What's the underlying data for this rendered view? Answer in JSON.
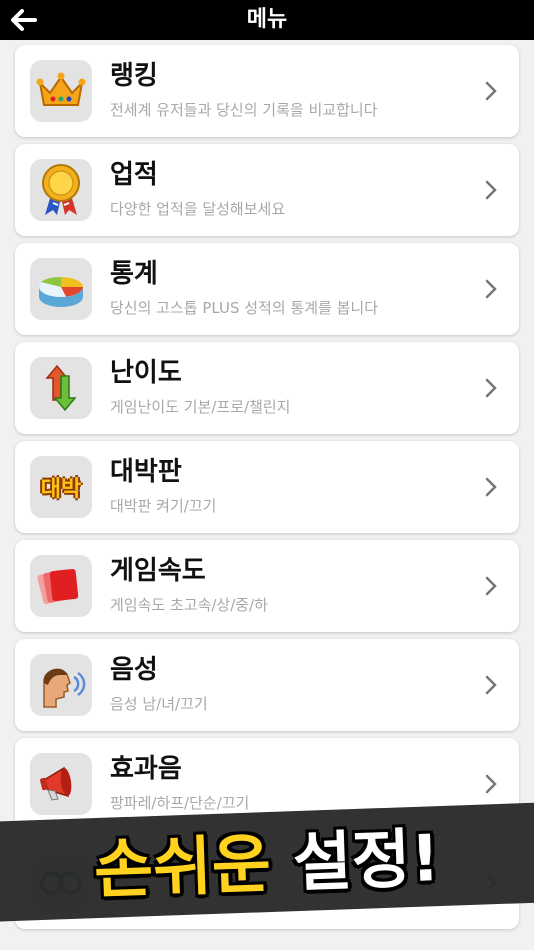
{
  "header": {
    "title": "메뉴",
    "back_icon": "arrow-left-icon"
  },
  "menu": [
    {
      "id": "ranking",
      "title": "랭킹",
      "subtitle": "전세계 유저들과 당신의 기록을 비교합니다",
      "icon": "crown-icon"
    },
    {
      "id": "achievement",
      "title": "업적",
      "subtitle": "다양한 업적을 달성해보세요",
      "icon": "medal-icon"
    },
    {
      "id": "statistics",
      "title": "통계",
      "subtitle": "당신의 고스톱 PLUS 성적의 통계를 봅니다",
      "icon": "pie-chart-icon"
    },
    {
      "id": "difficulty",
      "title": "난이도",
      "subtitle": "게임난이도 기본/프로/챌린지",
      "icon": "up-down-arrows-icon"
    },
    {
      "id": "jackpot",
      "title": "대박판",
      "subtitle": "대박판 켜기/끄기",
      "icon": "jackpot-icon",
      "icon_text": "대박"
    },
    {
      "id": "game-speed",
      "title": "게임속도",
      "subtitle": "게임속도 초고속/상/중/하",
      "icon": "cards-speed-icon"
    },
    {
      "id": "voice",
      "title": "음성",
      "subtitle": "음성 남/녀/끄기",
      "icon": "speaking-head-icon"
    },
    {
      "id": "sound-effect",
      "title": "효과음",
      "subtitle": "팡파레/하프/단순/끄기",
      "icon": "megaphone-icon"
    },
    {
      "id": "hidden-item",
      "title": "",
      "subtitle": "",
      "icon": "partially-hidden-icon"
    }
  ],
  "promo": {
    "part1": "손쉬운",
    "part2": "설정!"
  },
  "colors": {
    "topbar": "#000000",
    "background": "#f1f1f1",
    "card": "#ffffff",
    "subtitle": "#a8a8a8",
    "promo_yellow": "#ffd21f"
  }
}
